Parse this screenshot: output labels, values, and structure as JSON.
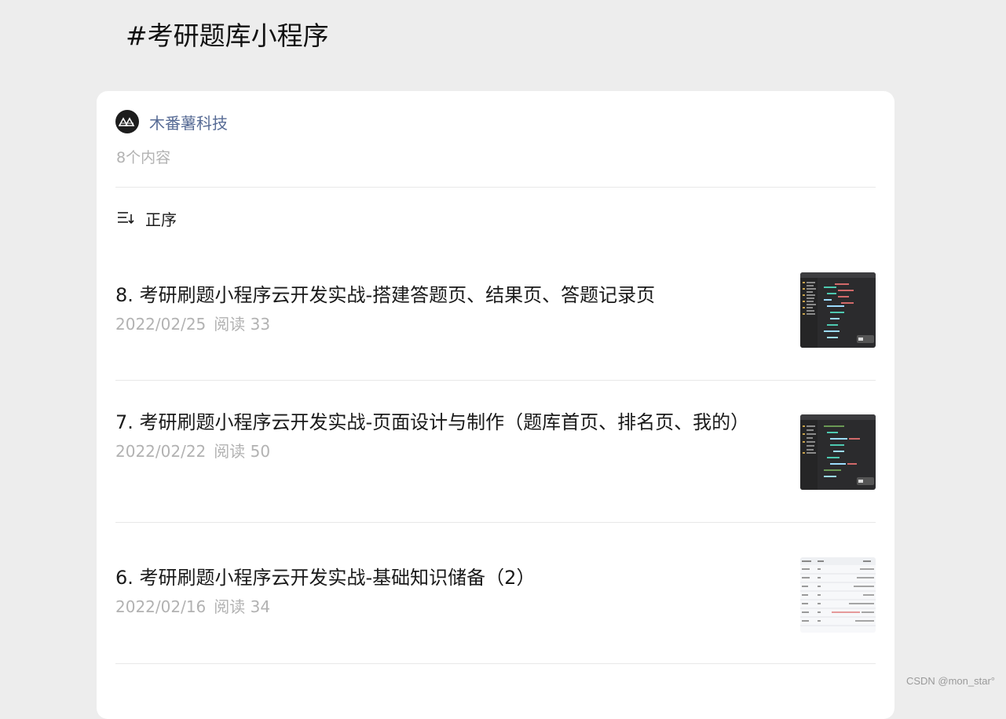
{
  "page": {
    "title": "#考研题库小程序"
  },
  "author": {
    "name": "木番薯科技",
    "avatar_icon": "logo-avatar-icon"
  },
  "collection": {
    "count_text": "8个内容"
  },
  "sort": {
    "icon": "sort-order-icon",
    "label": "正序"
  },
  "articles": [
    {
      "title": "8. 考研刷题小程序云开发实战-搭建答题页、结果页、答题记录页",
      "date": "2022/02/25",
      "reads": "阅读 33",
      "thumbnail": "code-editor-screenshot"
    },
    {
      "title": "7. 考研刷题小程序云开发实战-页面设计与制作（题库首页、排名页、我的）",
      "date": "2022/02/22",
      "reads": "阅读 50",
      "thumbnail": "code-editor-screenshot"
    },
    {
      "title": "6. 考研刷题小程序云开发实战-基础知识储备（2）",
      "date": "2022/02/16",
      "reads": "阅读 34",
      "thumbnail": "table-screenshot"
    }
  ],
  "watermark": {
    "text": "CSDN @mon_star°"
  },
  "colors": {
    "background": "#ededed",
    "card": "#ffffff",
    "author_link": "#576b95",
    "meta_gray": "#b2b2b2"
  }
}
